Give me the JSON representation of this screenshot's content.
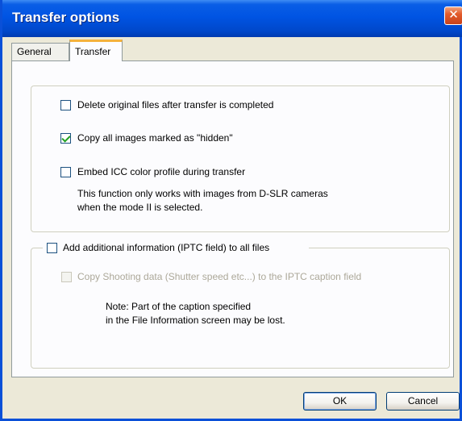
{
  "window": {
    "title": "Transfer options",
    "close_symbol": "✕"
  },
  "tabs": [
    {
      "label": "General",
      "active": false
    },
    {
      "label": "Transfer",
      "active": true
    }
  ],
  "transfer_group": {
    "delete_original": {
      "label": "Delete original files after transfer is completed",
      "checked": false
    },
    "copy_hidden": {
      "label": "Copy all images marked as \"hidden\"",
      "checked": true
    },
    "embed_icc": {
      "label": "Embed ICC color profile during transfer",
      "checked": false
    },
    "embed_note_line1": "This function only works with images from D-SLR cameras",
    "embed_note_line2": "when the mode II is selected."
  },
  "iptc_group": {
    "add_iptc": {
      "label": "Add additional information (IPTC field) to all files",
      "checked": false
    },
    "copy_shooting": {
      "label": "Copy Shooting data (Shutter speed etc...) to the IPTC caption field",
      "checked": false,
      "disabled": true
    },
    "note_line1": "Note: Part of the caption specified",
    "note_line2": "in the File Information screen may be lost."
  },
  "buttons": {
    "ok": "OK",
    "cancel": "Cancel"
  }
}
